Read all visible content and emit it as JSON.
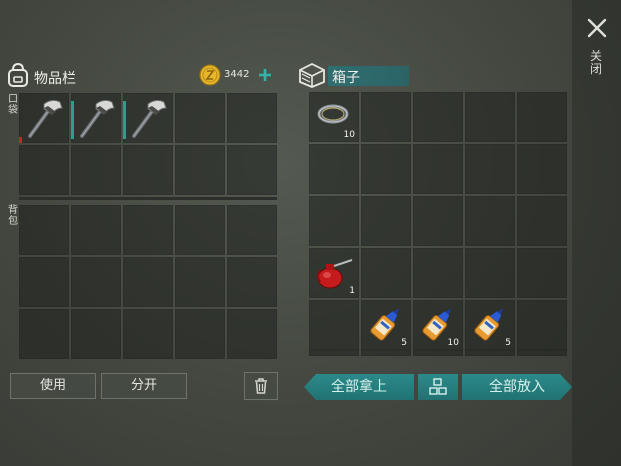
{
  "inventory": {
    "title": "物品栏",
    "coin_count": "3442",
    "pocket_label": "口袋",
    "backpack_label": "背包",
    "use_button": "使用",
    "split_button": "分开",
    "pocket_items": [
      {
        "slot": 0,
        "icon": "hatchet-icon",
        "durability_color": "#cc2222"
      },
      {
        "slot": 1,
        "icon": "hatchet-icon"
      },
      {
        "slot": 2,
        "icon": "hatchet-icon"
      }
    ]
  },
  "box": {
    "title": "箱子",
    "take_all_button": "全部拿上",
    "put_all_button": "全部放入",
    "items": {
      "wire": {
        "icon": "wire-coil-icon",
        "qty": "10"
      },
      "oil": {
        "icon": "oil-can-icon",
        "qty": "1"
      },
      "glue1": {
        "icon": "glue-tube-icon",
        "qty": "5"
      },
      "glue2": {
        "icon": "glue-tube-icon",
        "qty": "10"
      },
      "glue3": {
        "icon": "glue-tube-icon",
        "qty": "5"
      }
    }
  },
  "close_label": "关闭",
  "colors": {
    "accent": "#2a8a86",
    "coin": "#e8b82a"
  }
}
